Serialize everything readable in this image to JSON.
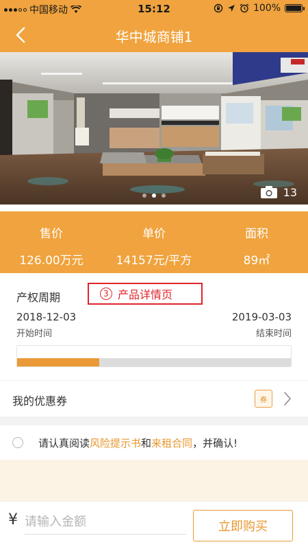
{
  "status_bar": {
    "carrier": "中国移动",
    "time": "15:12",
    "battery_text": "100%",
    "battery_level": 1.0
  },
  "header": {
    "title": "华中城商铺1",
    "back_icon": "chevron-left-icon"
  },
  "gallery": {
    "photo_count": "13",
    "total_dots": 3,
    "active_dot": 1,
    "camera_icon": "camera-icon"
  },
  "price_bar": {
    "items": [
      {
        "label": "售价",
        "value": "126.00万元"
      },
      {
        "label": "单价",
        "value": "14157元/平方"
      },
      {
        "label": "面积",
        "value": "89㎡"
      }
    ]
  },
  "ownership": {
    "title": "产权周期",
    "start_date": "2018-12-03",
    "start_label": "开始时间",
    "end_date": "2019-03-03",
    "end_label": "结束时间",
    "progress": 0.3
  },
  "annotation": {
    "number": "3",
    "text": "产品详情页",
    "color": "#e0242a"
  },
  "coupon": {
    "label": "我的优惠券",
    "icon_text": "券"
  },
  "agreement": {
    "prefix": "请认真阅读",
    "link1": "风险提示书",
    "middle": "和",
    "link2": "来租合同",
    "suffix": "，并确认!"
  },
  "purchase": {
    "currency_symbol": "¥",
    "input_placeholder": "请输入金额",
    "input_value": "",
    "buy_label": "立即购买"
  },
  "colors": {
    "accent": "#f0a33e",
    "link": "#e8962e",
    "annotation_red": "#e0242a",
    "beige_band": "#fcf3e4"
  }
}
